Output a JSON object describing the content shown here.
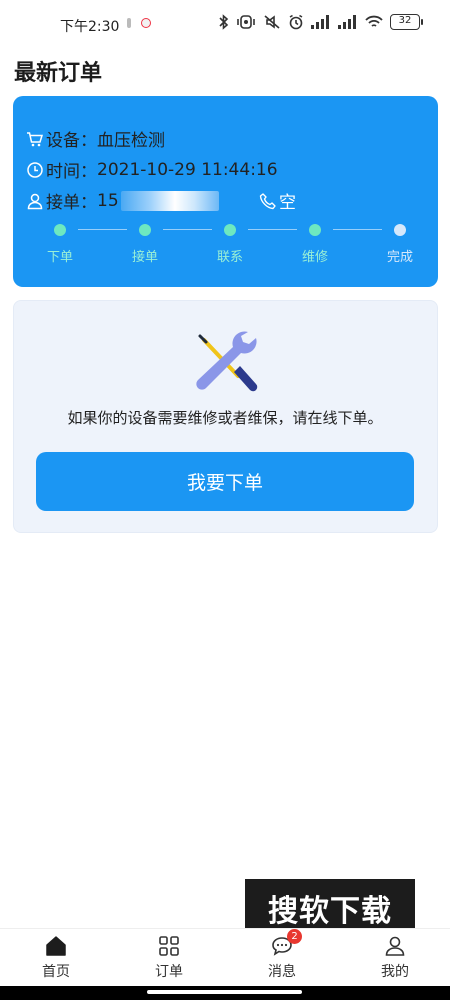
{
  "status_bar": {
    "time": "下午2:30",
    "battery": "32"
  },
  "page_title": "最新订单",
  "order": {
    "device_label": "设备：",
    "device_value": "血压检测",
    "time_label": "时间：",
    "time_value": "2021-10-29 11:44:16",
    "taker_label": "接单：",
    "taker_phone_prefix": "15",
    "contact_value": "空"
  },
  "progress_steps": [
    {
      "label": "下单",
      "done": true
    },
    {
      "label": "接单",
      "done": true
    },
    {
      "label": "联系",
      "done": true
    },
    {
      "label": "维修",
      "done": true
    },
    {
      "label": "完成",
      "done": false
    }
  ],
  "colors": {
    "primary": "#1b96f3",
    "step_done": "#6ee8c0",
    "step_label": "#9af0d6",
    "step_pending": "#d5e8fb",
    "badge": "#e8372f"
  },
  "info_card": {
    "icon": "wrench-screwdriver-icon",
    "message": "如果你的设备需要维修或者维保，请在线下单。",
    "button_label": "我要下单"
  },
  "watermark": "搜软下载",
  "tabs": [
    {
      "label": "首页",
      "icon": "home-icon",
      "active": true
    },
    {
      "label": "订单",
      "icon": "grid-icon",
      "active": false
    },
    {
      "label": "消息",
      "icon": "chat-icon",
      "active": false,
      "badge": "2"
    },
    {
      "label": "我的",
      "icon": "user-icon",
      "active": false
    }
  ]
}
